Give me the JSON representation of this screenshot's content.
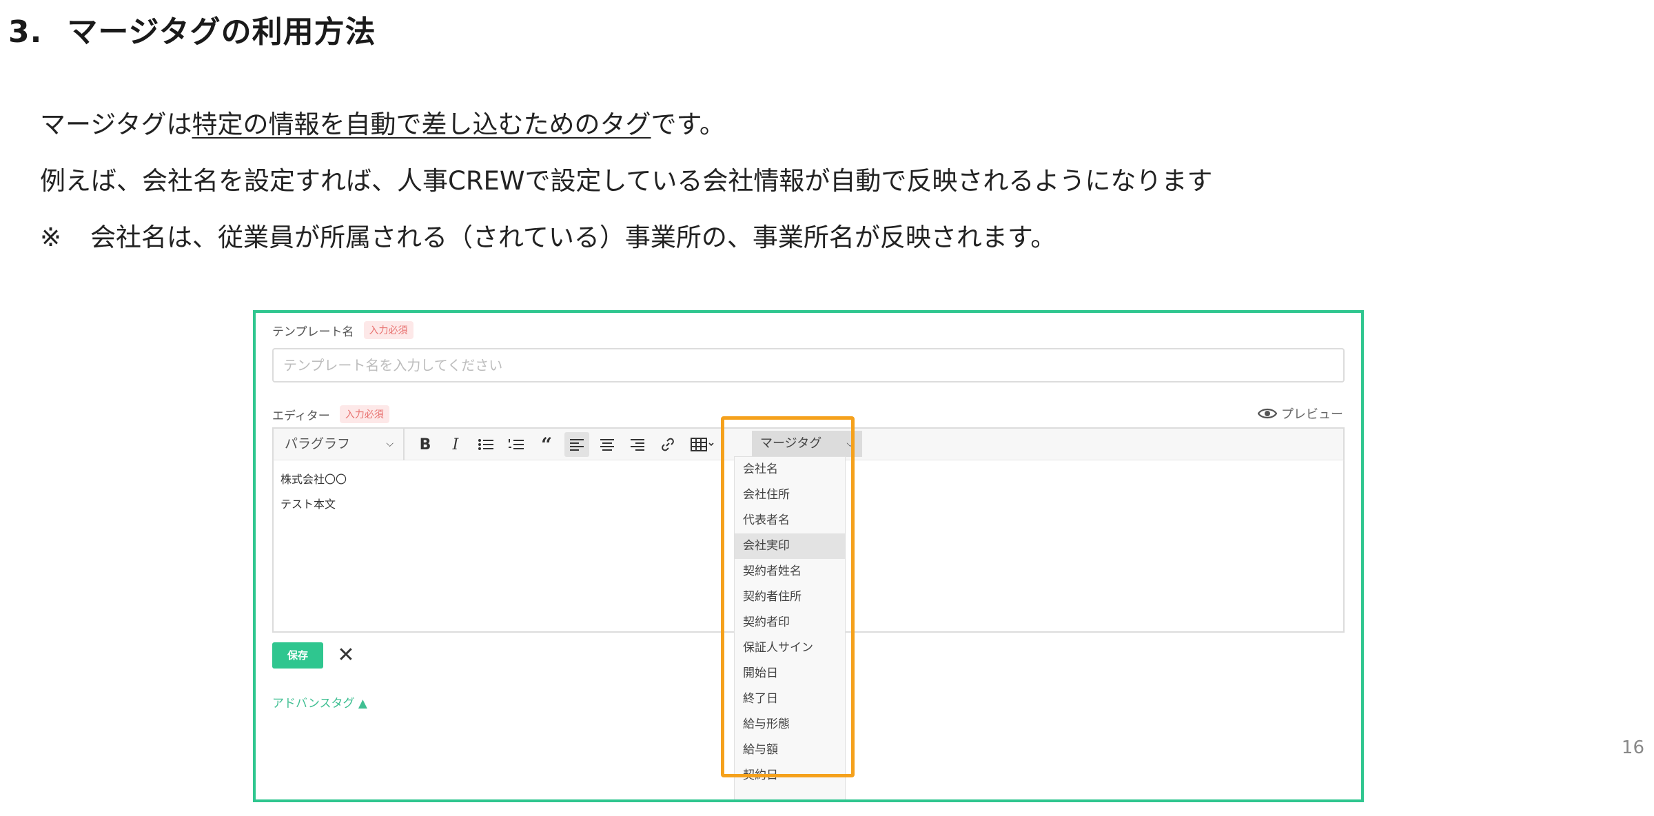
{
  "title": {
    "number": "3.",
    "text": "マージタグの利用方法"
  },
  "intro": {
    "line1_prefix": "マージタグは",
    "line1_underlined": "特定の情報を自動で差し込むためのタグ",
    "line1_suffix": "です。",
    "line2": "例えば、会社名を設定すれば、人事CREWで設定している会社情報が自動で反映されるようになります",
    "note_mark": "※",
    "note_text": "会社名は、従業員が所属される（されている）事業所の、事業所名が反映されます。"
  },
  "page_number": "16",
  "screenshot": {
    "template_label": "テンプレート名",
    "required_badge": "入力必須",
    "template_placeholder": "テンプレート名を入力してください",
    "editor_label": "エディター",
    "preview_label": "プレビュー",
    "paragraph_select": "パラグラフ",
    "merge_tag_select": "マージタグ",
    "editor_lines": [
      "株式会社〇〇",
      "テスト本文"
    ],
    "save_label": "保存",
    "advanced_tag_label": "アドバンスタグ ▲",
    "merge_tags": [
      "会社名",
      "会社住所",
      "代表者名",
      "会社実印",
      "契約者姓名",
      "契約者住所",
      "契約者印",
      "保証人サイン",
      "開始日",
      "終了日",
      "給与形態",
      "給与額",
      "契約日"
    ],
    "highlighted_tag": "会社実印",
    "colors": {
      "frame": "#2fc68f",
      "highlight_box": "#f5a11c",
      "accent": "#2fc68f",
      "badge": "#e8716f"
    }
  }
}
